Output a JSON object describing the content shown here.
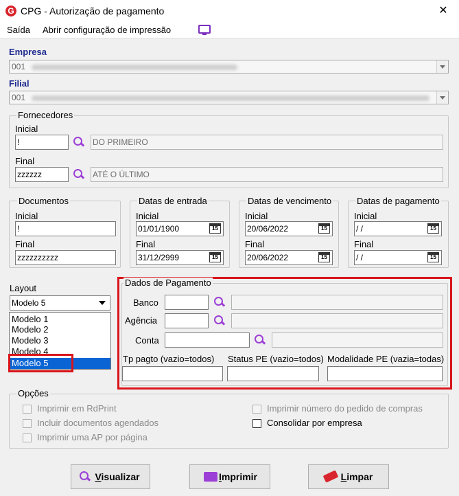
{
  "window": {
    "title": "CPG - Autorização de pagamento",
    "close": "✕"
  },
  "menu": {
    "items": [
      "Saída",
      "Abrir configuração de impressão"
    ]
  },
  "empresa": {
    "label": "Empresa",
    "value": "001"
  },
  "filial": {
    "label": "Filial",
    "value": "001"
  },
  "fornecedores": {
    "title": "Fornecedores",
    "inicial_label": "Inicial",
    "inicial_value": "!",
    "inicial_desc": "DO PRIMEIRO",
    "final_label": "Final",
    "final_value": "zzzzzz",
    "final_desc": "ATÉ O ÚLTIMO"
  },
  "documentos": {
    "title": "Documentos",
    "inicial_label": "Inicial",
    "inicial_value": "!",
    "final_label": "Final",
    "final_value": "zzzzzzzzzz"
  },
  "datas_entrada": {
    "title": "Datas de entrada",
    "inicial_label": "Inicial",
    "inicial_value": "01/01/1900",
    "final_label": "Final",
    "final_value": "31/12/2999"
  },
  "datas_vencimento": {
    "title": "Datas de vencimento",
    "inicial_label": "Inicial",
    "inicial_value": "20/06/2022",
    "final_label": "Final",
    "final_value": "20/06/2022"
  },
  "datas_pagamento": {
    "title": "Datas de pagamento",
    "inicial_label": "Inicial",
    "inicial_value": " /  /",
    "final_label": "Final",
    "final_value": " /  /"
  },
  "calendar_glyph": "15",
  "layout": {
    "label": "Layout",
    "selected": "Modelo 5",
    "options": [
      "Modelo 1",
      "Modelo 2",
      "Modelo 3",
      "Modelo 4",
      "Modelo 5"
    ]
  },
  "pagamento": {
    "title": "Dados de Pagamento",
    "banco_label": "Banco",
    "agencia_label": "Agência",
    "conta_label": "Conta",
    "tp_pagto_label": "Tp pagto (vazio=todos)",
    "status_pe_label": "Status PE (vazio=todos)",
    "modalidade_label": "Modalidade PE (vazia=todas)"
  },
  "opcoes": {
    "title": "Opções",
    "items": [
      "Imprimir em RdPrint",
      "Incluir documentos agendados",
      "Imprimir uma AP por página",
      "Imprimir número do pedido de compras",
      "Consolidar por empresa"
    ]
  },
  "buttons": {
    "visualizar_first": "V",
    "visualizar_rest": "isualizar",
    "imprimir_first": "I",
    "imprimir_rest": "mprimir",
    "limpar_first": "L",
    "limpar_rest": "impar"
  },
  "colors": {
    "accent_label": "#1f2b8f",
    "highlight_red": "#d9141b",
    "icon_purple": "#9c3fd6",
    "selection": "#0a64d4"
  }
}
